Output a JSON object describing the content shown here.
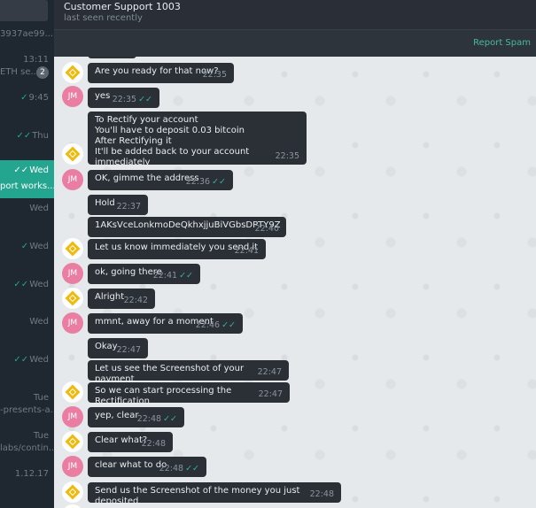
{
  "sidebar": {
    "rows": [
      {
        "time": "",
        "text": "3937ae99..."
      },
      {
        "time": "13:11",
        "text": "ETH se...",
        "badge": "2"
      },
      {
        "time": "9:45",
        "checks": "✓",
        "text": ""
      },
      {
        "time": "Thu",
        "checks": "✓✓",
        "text": ""
      },
      {
        "time": "Wed",
        "checks": "✓✓",
        "text": "port works...",
        "active": true
      },
      {
        "time": "Wed",
        "text": ""
      },
      {
        "time": "Wed",
        "checks": "✓",
        "text": ""
      },
      {
        "time": "Wed",
        "checks": "✓✓",
        "text": ""
      },
      {
        "time": "Wed",
        "text": ""
      },
      {
        "time": "Wed",
        "checks": "✓✓",
        "text": ""
      },
      {
        "time": "Tue",
        "text": "-presents-a..."
      },
      {
        "time": "Tue",
        "text": "labs/contin..."
      },
      {
        "time": "1.12.17",
        "text": ""
      }
    ]
  },
  "header": {
    "title": "Customer Support 1003",
    "status": "last seen recently",
    "report_spam": "Report Spam"
  },
  "messages": [
    {
      "from": "support",
      "text": "Are you ready for that now?",
      "time": "22:35"
    },
    {
      "from": "jm",
      "text": "yes",
      "time": "22:35",
      "ticks": "✓✓"
    },
    {
      "from": "support",
      "text": "To Rectify your account\nYou'll have to deposit 0.03 bitcoin\nAfter Rectifying it\nIt'll be added back to your account immediately",
      "time": "22:35"
    },
    {
      "from": "jm",
      "text": "OK, gimme the address",
      "time": "22:36",
      "ticks": "✓✓"
    },
    {
      "from": "support",
      "text": "Hold",
      "time": "22:37"
    },
    {
      "from": "support",
      "text": "1AKsVceLonkmoDeQkhxjjuBiVGbsDPTY9Z",
      "time": "22:40"
    },
    {
      "from": "support",
      "text": "Let us know immediately you send it",
      "time": "22:41"
    },
    {
      "from": "jm",
      "text": "ok, going there",
      "time": "22:41",
      "ticks": "✓✓"
    },
    {
      "from": "support",
      "text": "Alright",
      "time": "22:42"
    },
    {
      "from": "jm",
      "text": "mmnt, away for a moment",
      "time": "22:46",
      "ticks": "✓✓"
    },
    {
      "from": "support",
      "text": "Okay",
      "time": "22:47"
    },
    {
      "from": "support",
      "text": "Let us see the Screenshot of your payment",
      "time": "22:47"
    },
    {
      "from": "support",
      "text": "So we can start processing the Rectification",
      "time": "22:47"
    },
    {
      "from": "jm",
      "text": "yep, clear",
      "time": "22:48",
      "ticks": "✓✓"
    },
    {
      "from": "support",
      "text": "Clear what?",
      "time": "22:48"
    },
    {
      "from": "jm",
      "text": "clear what to do",
      "time": "22:48",
      "ticks": "✓✓"
    },
    {
      "from": "support",
      "text": "Send us the Screenshot of the money you just deposited",
      "time": "22:48"
    }
  ],
  "avatar_jm": "JM",
  "colors": {
    "accent": "#23a58f",
    "bubble": "#2b3036",
    "jm_avatar": "#e97ea2",
    "support_logo": "#f0b90b"
  }
}
